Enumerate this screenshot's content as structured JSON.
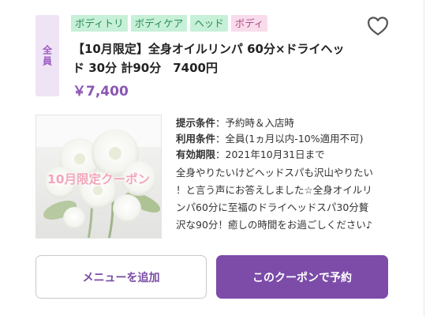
{
  "badge": {
    "target": "全員"
  },
  "tags": [
    {
      "label": "ボディトリ",
      "color": "#c7f0d8"
    },
    {
      "label": "ボディケア",
      "color": "#c7f0d8"
    },
    {
      "label": "ヘッド",
      "color": "#c7f0d8"
    },
    {
      "label": "ボディ",
      "color": "#f9dcec"
    }
  ],
  "coupon": {
    "title_line1": "【10月限定】全身オイルリンパ 60分×ドライヘッ",
    "title_line2": "ド 30分 計90分　7400円",
    "price": "￥7,400",
    "image_label": "10月限定クーポン",
    "conditions": [
      {
        "key": "提示条件",
        "value": "：予約時＆入店時"
      },
      {
        "key": "利用条件",
        "value": "：全員(1ヵ月以内-10%適用不可)"
      },
      {
        "key": "有効期限",
        "value": "：2021年10月31日まで"
      }
    ],
    "description_lines": [
      "全身やりたいけどヘッドスパも沢山やりたい",
      "！と言う声にお答えしました☆全身オイルリ",
      "ンパ60分に至福のドライヘッドスパ30分贅",
      "沢な90分！癒しの時間をお過ごしください♪"
    ]
  },
  "buttons": {
    "add_menu": "メニューを追加",
    "reserve": "このクーポンで予約"
  },
  "icons": {
    "favorite": "heart-outline-icon"
  },
  "colors": {
    "accent": "#7c4ca8",
    "price": "#8a56b4"
  }
}
